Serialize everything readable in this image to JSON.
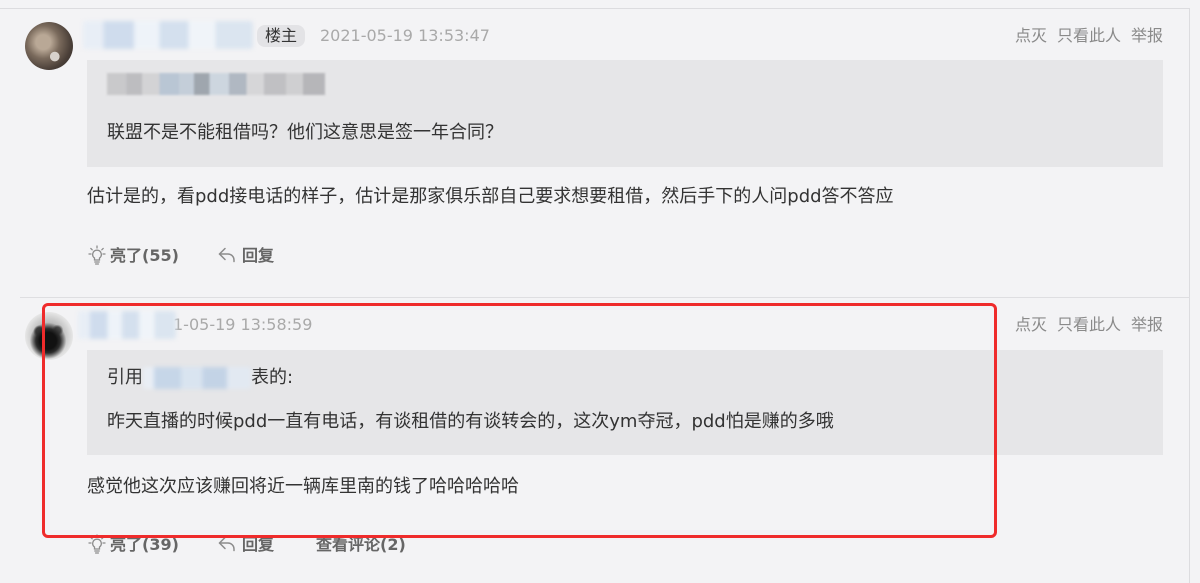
{
  "colors": {
    "page_bg": "#f3f3f5",
    "text": "#333333",
    "muted": "#a9a9a9",
    "quote_bg": "#e6e6e8",
    "annotation": "#ef2b2b"
  },
  "icons": {
    "like": "lightbulb-icon",
    "reply": "reply-arrow-icon"
  },
  "comments": [
    {
      "author_badge": "楼主",
      "time": "2021-05-19 13:53:47",
      "links": {
        "dislike": "点灭",
        "only_author": "只看此人",
        "report": "举报"
      },
      "quote": {
        "text": "联盟不是不能租借吗？他们这意思是签一年合同？"
      },
      "body": "估计是的，看pdd接电话的样子，估计是那家俱乐部自己要求想要租借，然后手下的人问pdd答不答应",
      "actions": {
        "like": "亮了(55)",
        "reply": "回复"
      }
    },
    {
      "time": "1-05-19 13:58:59",
      "links": {
        "dislike": "点灭",
        "only_author": "只看此人",
        "report": "举报"
      },
      "quote": {
        "cite_prefix": "引用",
        "cite_suffix": "表的:",
        "text": "昨天直播的时候pdd一直有电话，有谈租借的有谈转会的，这次ym夺冠，pdd怕是赚的多哦"
      },
      "body": "感觉他这次应该赚回将近一辆库里南的钱了哈哈哈哈哈",
      "actions": {
        "like": "亮了(39)",
        "reply": "回复",
        "view_comments": "查看评论(2)"
      }
    }
  ]
}
